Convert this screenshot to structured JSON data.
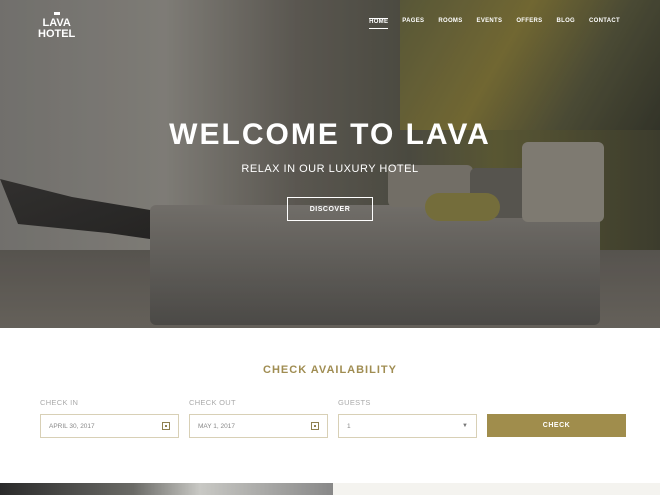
{
  "brand": {
    "line1": "LAVA",
    "line2": "HOTEL"
  },
  "nav": [
    "HOME",
    "PAGES",
    "ROOMS",
    "EVENTS",
    "OFFERS",
    "BLOG",
    "CONTACT"
  ],
  "hero": {
    "title": "WELCOME TO LAVA",
    "subtitle": "RELAX IN OUR LUXURY HOTEL",
    "button": "DISCOVER"
  },
  "booking": {
    "title": "CHECK AVAILABILITY",
    "check_in": {
      "label": "CHECK IN",
      "value": "APRIL 30, 2017"
    },
    "check_out": {
      "label": "CHECK OUT",
      "value": "MAY 1, 2017"
    },
    "guests": {
      "label": "GUESTS",
      "value": "1"
    },
    "button": "CHECK"
  },
  "colors": {
    "accent": "#a08d4c"
  }
}
